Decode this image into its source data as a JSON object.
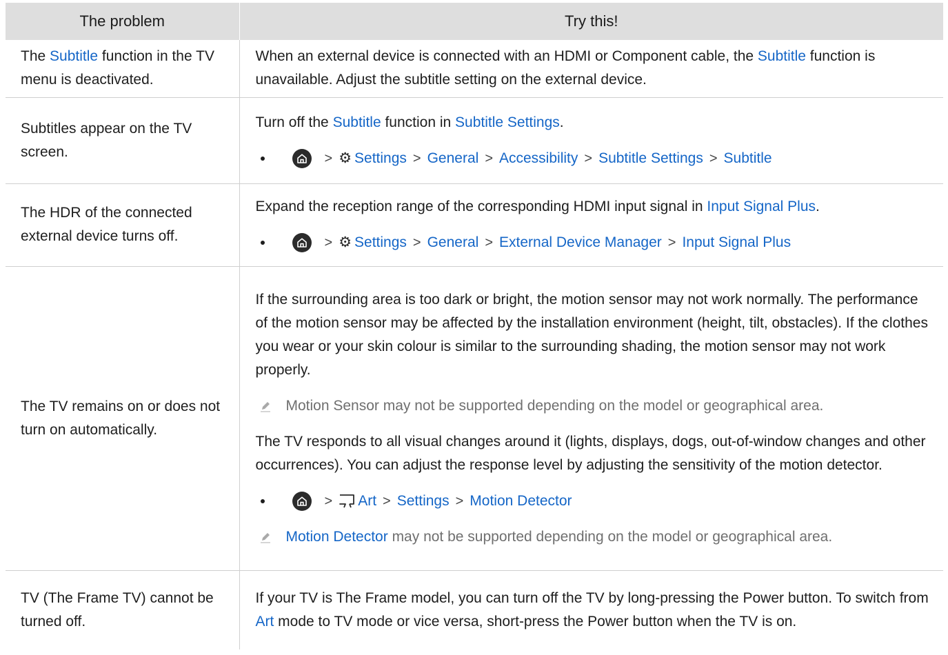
{
  "header": {
    "problem": "The problem",
    "solution": "Try this!"
  },
  "row1": {
    "p_a": "The ",
    "p_link": "Subtitle",
    "p_b": " function in the TV menu is deactivated.",
    "s_a": "When an external device is connected with an HDMI or Component cable, the ",
    "s_link": "Subtitle",
    "s_b": " function is unavailable. Adjust the subtitle setting on the external device."
  },
  "row2": {
    "problem": "Subtitles appear on the TV screen.",
    "s_a": "Turn off the ",
    "s_link1": "Subtitle",
    "s_b": " function in ",
    "s_link2": "Subtitle Settings",
    "s_c": ".",
    "path": [
      "Settings",
      "General",
      "Accessibility",
      "Subtitle Settings",
      "Subtitle"
    ]
  },
  "row3": {
    "problem": "The HDR of the connected external device turns off.",
    "s_a": "Expand the reception range of the corresponding HDMI input signal in ",
    "s_link": "Input Signal Plus",
    "s_b": ".",
    "path": [
      "Settings",
      "General",
      "External Device Manager",
      "Input Signal Plus"
    ]
  },
  "row4": {
    "problem": "The TV remains on or does not turn on automatically.",
    "s1": "If the surrounding area is too dark or bright, the motion sensor may not work normally. The performance of the motion sensor may be affected by the installation environment (height, tilt, obstacles). If the clothes you wear or your skin colour is similar to the surrounding shading, the motion sensor may not work properly.",
    "note1": "Motion Sensor may not be supported depending on the model or geographical area.",
    "s2": "The TV responds to all visual changes around it (lights, displays, dogs, out-of-window changes and other occurrences). You can adjust the response level by adjusting the sensitivity of the motion detector.",
    "path": [
      "Art",
      "Settings",
      "Motion Detector"
    ],
    "note2_link": "Motion Detector",
    "note2_rest": " may not be supported depending on the model or geographical area."
  },
  "row5": {
    "problem": "TV (The Frame TV) cannot be turned off.",
    "s_a": "If your TV is The Frame model, you can turn off the TV by long-pressing the Power button. To switch from ",
    "s_link": "Art",
    "s_b": " mode to TV mode or vice versa, short-press the Power button when the TV is on."
  },
  "icons": [
    "home-icon",
    "chevron-right-icon",
    "gear-icon",
    "frame-art-icon",
    "pencil-note-icon",
    "bullet-icon"
  ],
  "colors": {
    "link": "#1566c7",
    "header_bg": "#dedede",
    "note_text": "#6f6f6f",
    "border": "#cfcfcf"
  }
}
